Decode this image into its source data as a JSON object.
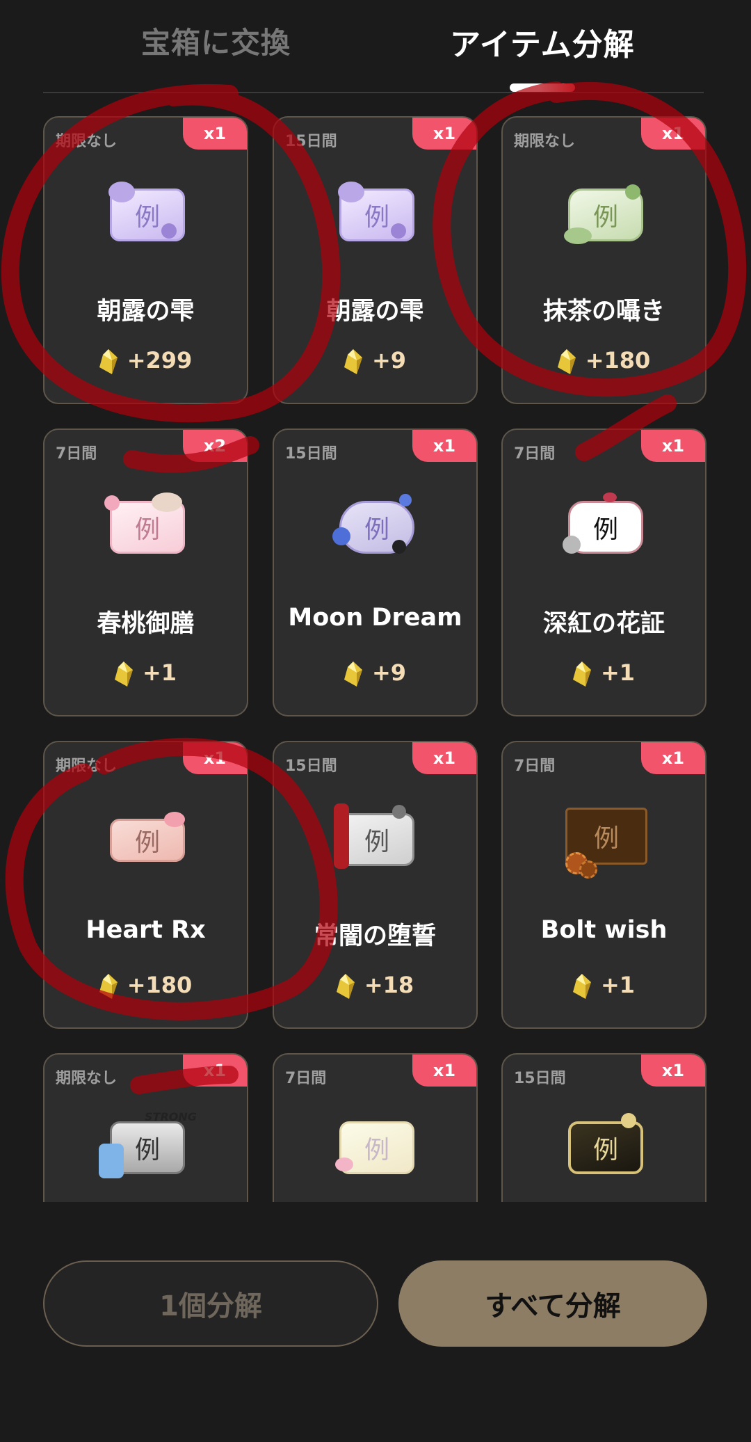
{
  "tabs": {
    "exchange": "宝箱に交換",
    "decompose": "アイテム分解"
  },
  "colors": {
    "background": "#1b1b1b",
    "card": "#2d2d2d",
    "qty_badge": "#f1546b",
    "reward_text": "#f4ddb6",
    "accent_button": "#8d7d64"
  },
  "items": [
    {
      "expiry": "期限なし",
      "qty": "x1",
      "name": "朝露の雫",
      "reward": "+299",
      "thumb_text": "例"
    },
    {
      "expiry": "15日間",
      "qty": "x1",
      "name": "朝露の雫",
      "reward": "+9",
      "thumb_text": "例"
    },
    {
      "expiry": "期限なし",
      "qty": "x1",
      "name": "抹茶の囁き",
      "reward": "+180",
      "thumb_text": "例"
    },
    {
      "expiry": "7日間",
      "qty": "x2",
      "name": "春桃御膳",
      "reward": "+1",
      "thumb_text": "例"
    },
    {
      "expiry": "15日間",
      "qty": "x1",
      "name": "Moon Dream",
      "reward": "+9",
      "thumb_text": "例"
    },
    {
      "expiry": "7日間",
      "qty": "x1",
      "name": "深紅の花証",
      "reward": "+1",
      "thumb_text": "例"
    },
    {
      "expiry": "期限なし",
      "qty": "x1",
      "name": "Heart Rx",
      "reward": "+180",
      "thumb_text": "例"
    },
    {
      "expiry": "15日間",
      "qty": "x1",
      "name": "常闇の堕誓",
      "reward": "+18",
      "thumb_text": "例"
    },
    {
      "expiry": "7日間",
      "qty": "x1",
      "name": "Bolt wish",
      "reward": "+1",
      "thumb_text": "例"
    },
    {
      "expiry": "期限なし",
      "qty": "x1",
      "name": "",
      "reward": "",
      "thumb_text": "例",
      "thumb_label": "STRONG"
    },
    {
      "expiry": "7日間",
      "qty": "x1",
      "name": "",
      "reward": "",
      "thumb_text": "例"
    },
    {
      "expiry": "15日間",
      "qty": "x1",
      "name": "",
      "reward": "",
      "thumb_text": "例"
    }
  ],
  "buttons": {
    "decompose_one": "1個分解",
    "decompose_all": "すべて分解"
  }
}
